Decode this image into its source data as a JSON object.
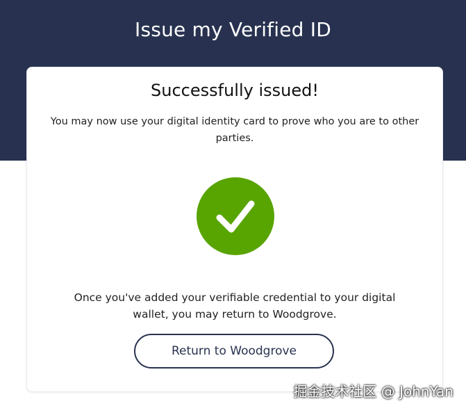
{
  "header": {
    "title": "Issue my Verified ID"
  },
  "card": {
    "title": "Successfully issued!",
    "description": "You may now use your digital identity card to prove who you are to other parties.",
    "status_icon": "checkmark-circle-icon",
    "return_message": "Once you've added your verifiable credential to your digital wallet, you may return to Woodgrove.",
    "return_button_label": "Return to Woodgrove"
  },
  "watermark": {
    "text": "掘金技术社区 @ JohnYan"
  },
  "colors": {
    "header_background": "#283250",
    "success_green": "#58a400",
    "button_border": "#283250"
  }
}
